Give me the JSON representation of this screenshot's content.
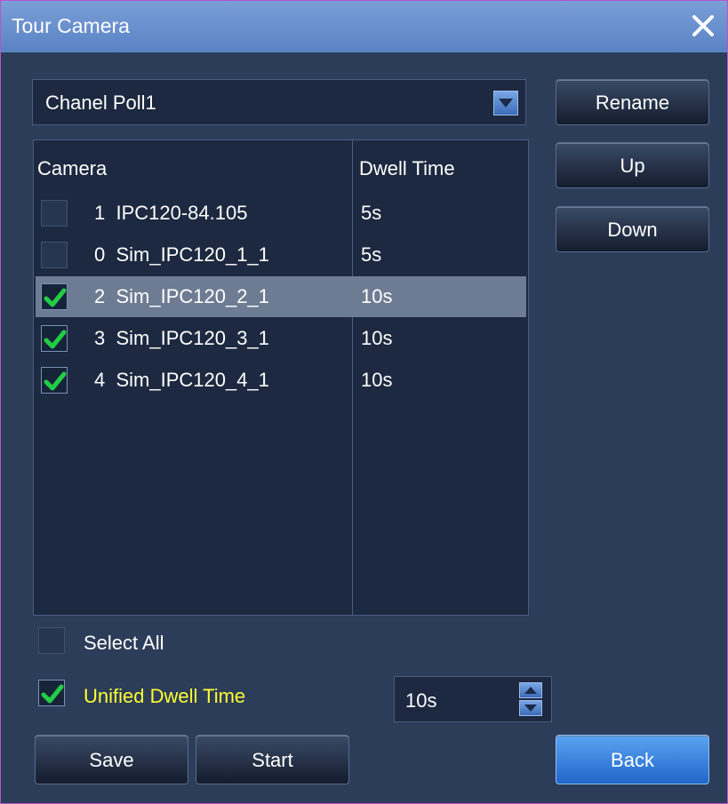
{
  "window": {
    "title": "Tour Camera"
  },
  "poll": {
    "selected": "Chanel Poll1"
  },
  "buttons": {
    "rename": "Rename",
    "up": "Up",
    "down": "Down",
    "save": "Save",
    "start": "Start",
    "back": "Back"
  },
  "table": {
    "headers": {
      "camera": "Camera",
      "dwell": "Dwell Time"
    },
    "rows": [
      {
        "camera": "1  IPC120-84.105",
        "dwell": "5s",
        "checked": false,
        "selected": false
      },
      {
        "camera": "0  Sim_IPC120_1_1",
        "dwell": "5s",
        "checked": false,
        "selected": false
      },
      {
        "camera": "2  Sim_IPC120_2_1",
        "dwell": "10s",
        "checked": true,
        "selected": true
      },
      {
        "camera": "3  Sim_IPC120_3_1",
        "dwell": "10s",
        "checked": true,
        "selected": false
      },
      {
        "camera": "4  Sim_IPC120_4_1",
        "dwell": "10s",
        "checked": true,
        "selected": false
      }
    ]
  },
  "options": {
    "select_all": "Select All",
    "select_all_checked": false,
    "unified": "Unified  Dwell  Time",
    "unified_checked": true,
    "dwell_value": "10s"
  },
  "colors": {
    "accent_yellow": "#ffff33",
    "check_green": "#22cc44",
    "selected_row": "#6d7c92"
  }
}
